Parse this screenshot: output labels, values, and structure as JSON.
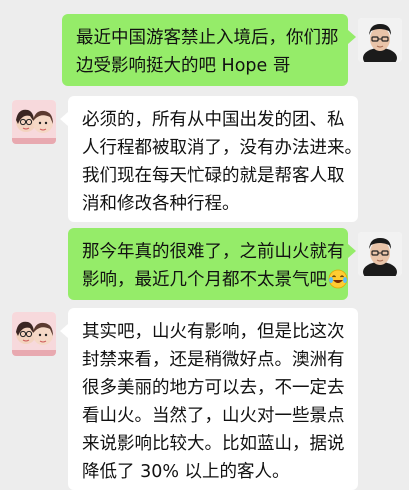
{
  "messages": [
    {
      "side": "right",
      "lines": [
        "最近中国游客禁止入境后，你们那",
        "边受影响挺大的吧 Hope 哥"
      ]
    },
    {
      "side": "left",
      "lines": [
        "必须的，所有从中国出发的团、私",
        "人行程都被取消了，没有办法进来。",
        "我们现在每天忙碌的就是帮客人取",
        "消和修改各种行程。"
      ]
    },
    {
      "side": "right",
      "lines": [
        "那今年真的很难了，之前山火就有",
        "影响，最近几个月都不太景气吧"
      ],
      "emoji": "laughing-tears-emoji"
    },
    {
      "side": "left",
      "lines": [
        "其实吧，山火有影响，但是比这次",
        "封禁来看，还是稍微好点。澳洲有",
        "很多美丽的地方可以去，不一定去",
        "看山火。当然了，山火对一些景点",
        "来说影响比较大。比如蓝山，据说",
        "降低了 30% 以上的客人。"
      ]
    }
  ],
  "avatars": {
    "self": "man-with-glasses-avatar",
    "other": "cartoon-couple-avatar"
  },
  "colors": {
    "background": "#ededed",
    "outgoing_bubble": "#95ec69",
    "incoming_bubble": "#ffffff"
  }
}
